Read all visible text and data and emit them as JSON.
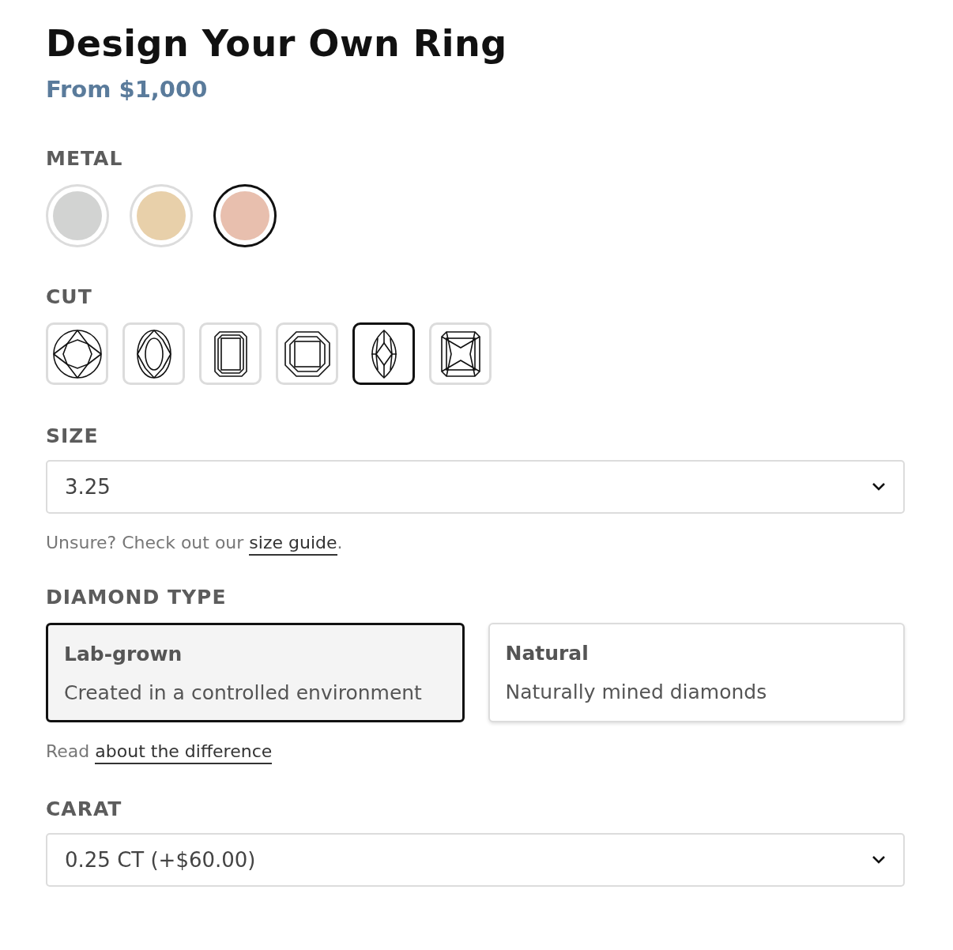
{
  "title": "Design Your Own Ring",
  "price": "From $1,000",
  "metal": {
    "label": "METAL",
    "options": [
      {
        "color": "#d2d3d2",
        "selected": false
      },
      {
        "color": "#e8d0aa",
        "selected": false
      },
      {
        "color": "#e8bfae",
        "selected": true
      }
    ]
  },
  "cut": {
    "label": "CUT",
    "options": [
      {
        "kind": "round",
        "selected": false
      },
      {
        "kind": "oval",
        "selected": false
      },
      {
        "kind": "emerald",
        "selected": false
      },
      {
        "kind": "asscher",
        "selected": false
      },
      {
        "kind": "marquise",
        "selected": true
      },
      {
        "kind": "radiant",
        "selected": false
      }
    ]
  },
  "size": {
    "label": "SIZE",
    "value": "3.25",
    "note": "Unsure? Check out our",
    "link": "size guide",
    "after": "."
  },
  "diamond_type": {
    "label": "DIAMOND TYPE",
    "options": [
      {
        "title": "Lab-grown",
        "description": "Created in a controlled environment",
        "selected": true
      },
      {
        "title": "Natural",
        "description": "Naturally mined diamonds",
        "selected": false
      }
    ],
    "note": "Read",
    "link": "about the difference"
  },
  "carat": {
    "label": "CARAT",
    "value": "0.25 CT (+$60.00)"
  }
}
